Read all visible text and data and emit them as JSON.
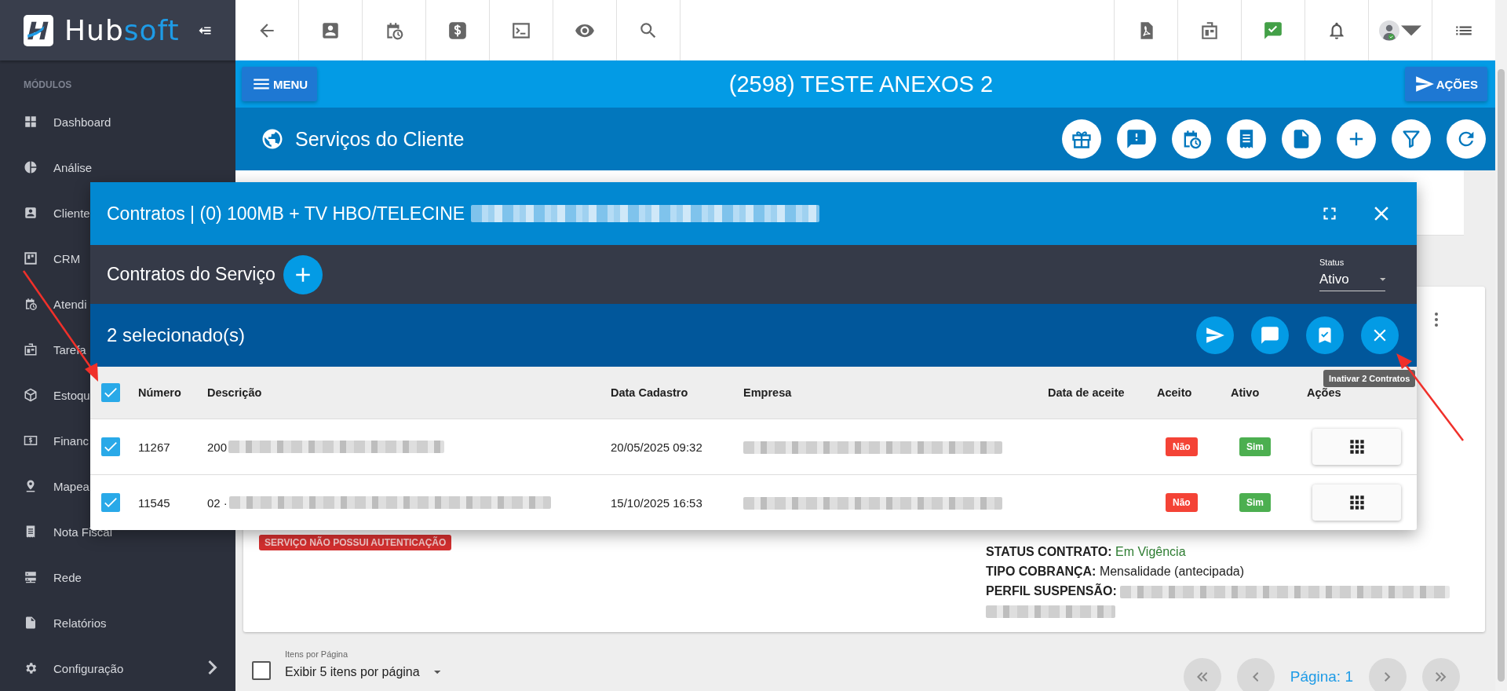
{
  "logo": {
    "primary": "Hub",
    "accent": "soft"
  },
  "sidebar": {
    "section": "MÓDULOS",
    "items": [
      {
        "label": "Dashboard",
        "submenu": false
      },
      {
        "label": "Análise",
        "submenu": false
      },
      {
        "label": "Cliente"
      },
      {
        "label": "CRM"
      },
      {
        "label": "Atendi"
      },
      {
        "label": "Tarefa"
      },
      {
        "label": "Estoqu"
      },
      {
        "label": "Financ"
      },
      {
        "label": "Mapea"
      },
      {
        "label": "Nota Fiscal",
        "submenu": false
      },
      {
        "label": "Rede",
        "submenu": false
      },
      {
        "label": "Relatórios",
        "submenu": false
      },
      {
        "label": "Configuração",
        "submenu": true
      }
    ]
  },
  "header": {
    "menu_button": "MENU",
    "title": "(2598) TESTE ANEXOS 2",
    "actions_button": "AÇÕES"
  },
  "section": {
    "title": "Serviços do Cliente"
  },
  "card": {
    "badge": "SERVIÇO NÃO POSSUI AUTENTICAÇÃO",
    "details": [
      {
        "label": "STATUS CONTRATO:",
        "value": "Em Vigência",
        "success": true
      },
      {
        "label": "TIPO COBRANÇA:",
        "value": "Mensalidade (antecipada)",
        "success": false
      },
      {
        "label": "PERFIL SUSPENSÃO:",
        "redacted": true
      }
    ]
  },
  "modal": {
    "title": "Contratos | (0) 100MB + TV HBO/TELECINE",
    "title_redacted": true,
    "subtitle": "Contratos do Serviço",
    "status_filter": {
      "label": "Status",
      "value": "Ativo"
    },
    "selection_text": "2 selecionado(s)",
    "tooltip": "Inativar 2 Contratos",
    "select_all_checked": true,
    "columns": [
      "Número",
      "Descrição",
      "Data Cadastro",
      "Empresa",
      "Data de aceite",
      "Aceito",
      "Ativo",
      "Ações"
    ],
    "rows": [
      {
        "checked": true,
        "number": "11267",
        "description": "200",
        "description_redacted": true,
        "created": "20/05/2025 09:32",
        "company_redacted": true,
        "accepted": {
          "label": "Não",
          "positive": false
        },
        "active": {
          "label": "Sim",
          "positive": true
        }
      },
      {
        "checked": true,
        "number": "11545",
        "description": "02 ·",
        "description_redacted": true,
        "created": "15/10/2025 16:53",
        "company_redacted": true,
        "accepted": {
          "label": "Não",
          "positive": false
        },
        "active": {
          "label": "Sim",
          "positive": true
        }
      }
    ]
  },
  "footer": {
    "select_all_checked": false,
    "per_page_label": "Itens por Página",
    "per_page_value": "Exibir 5 itens por página",
    "page_label": "Página: 1"
  }
}
